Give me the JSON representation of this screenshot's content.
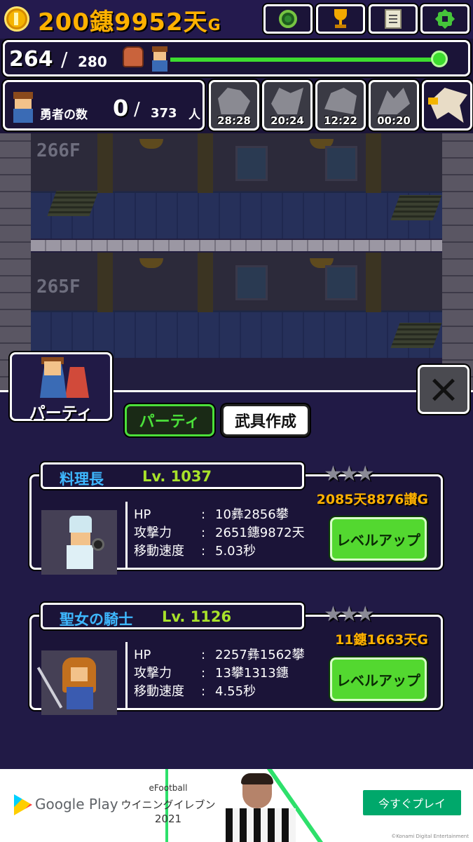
{
  "header": {
    "gold_amount": "200鏸9952天",
    "gold_unit": "G",
    "buttons": [
      "radar",
      "trophy",
      "log",
      "settings"
    ]
  },
  "floor_progress": {
    "current": "264",
    "max": "280",
    "progress": 0.95
  },
  "heroes": {
    "label": "勇者の数",
    "count": "0",
    "total": "373",
    "unit": "人"
  },
  "bosses": [
    {
      "timer": "28:28"
    },
    {
      "timer": "20:24"
    },
    {
      "timer": "12:22"
    },
    {
      "timer": "00:20"
    }
  ],
  "scene": {
    "upper_floor": "266F",
    "lower_floor": "265F"
  },
  "party_panel": {
    "tab_icon_label": "パーティ",
    "tabs": [
      {
        "label": "パーティ",
        "active": true
      },
      {
        "label": "武具作成",
        "active": false
      }
    ],
    "members": [
      {
        "name": "料理長",
        "level": "Lv. 1037",
        "stars": "★★★",
        "cost": "2085天8876讃G",
        "stats": [
          {
            "key": "HP",
            "sep": ":",
            "value": "10彝2856攀"
          },
          {
            "key": "攻撃力",
            "sep": ":",
            "value": "2651鏸9872天"
          },
          {
            "key": "移動速度",
            "sep": ":",
            "value": "5.03秒"
          }
        ],
        "button": "レベルアップ"
      },
      {
        "name": "聖女の騎士",
        "level": "Lv. 1126",
        "stars": "★★★",
        "cost": "11鏸1663天G",
        "stats": [
          {
            "key": "HP",
            "sep": ":",
            "value": "2257彝1562攀"
          },
          {
            "key": "攻撃力",
            "sep": ":",
            "value": "13攀1313鏸"
          },
          {
            "key": "移動速度",
            "sep": ":",
            "value": "4.55秒"
          }
        ],
        "button": "レベルアップ"
      }
    ]
  },
  "ad": {
    "store": "Google Play",
    "title_line1": "eFootball",
    "title_line2": "ウイニングイレブン",
    "title_line3": "2021",
    "cta": "今すぐプレイ",
    "copyright": "©Konami Digital Entertainment"
  },
  "colors": {
    "background": "#1b1438",
    "gold": "#ffb100",
    "accent_green": "#4be03a",
    "name_blue": "#3eb8ff",
    "level_green": "#a8e22a"
  }
}
